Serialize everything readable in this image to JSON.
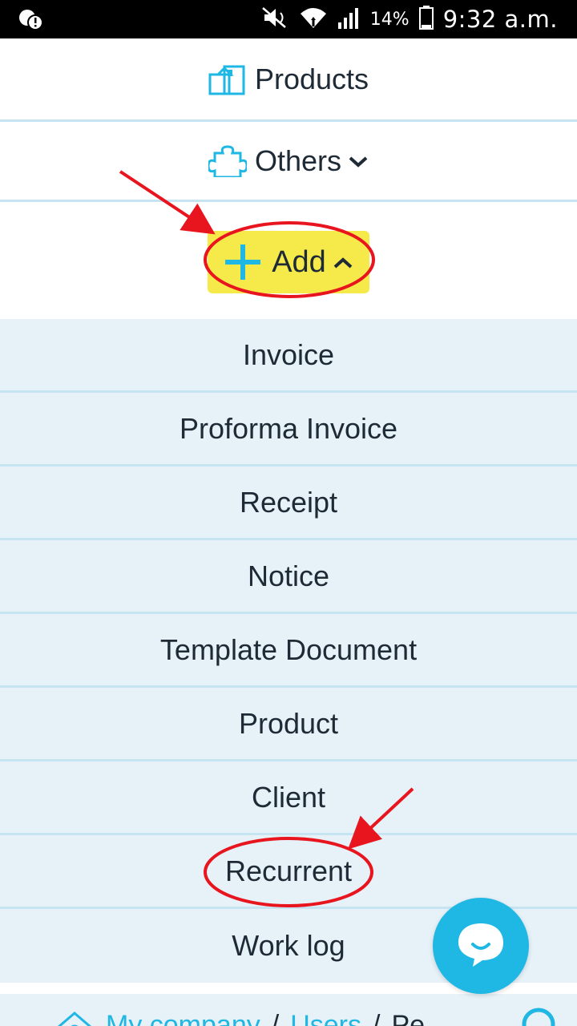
{
  "statusbar": {
    "battery_percent": "14%",
    "time": "9:32 a.m."
  },
  "menu": {
    "products_label": "Products",
    "others_label": "Others",
    "add_label": "Add"
  },
  "submenu": {
    "items": [
      {
        "label": "Invoice"
      },
      {
        "label": "Proforma Invoice"
      },
      {
        "label": "Receipt"
      },
      {
        "label": "Notice"
      },
      {
        "label": "Template Document"
      },
      {
        "label": "Product"
      },
      {
        "label": "Client"
      },
      {
        "label": "Recurrent"
      },
      {
        "label": "Work log"
      }
    ]
  },
  "breadcrumb": {
    "home": "My company",
    "sep1": "/",
    "users": "Users",
    "sep2": "/",
    "current": "Pe"
  },
  "colors": {
    "accent": "#1fb7e3",
    "highlight": "#f6ea4a",
    "submenu_bg": "#e6f1f8",
    "annotation": "#e8141e"
  }
}
